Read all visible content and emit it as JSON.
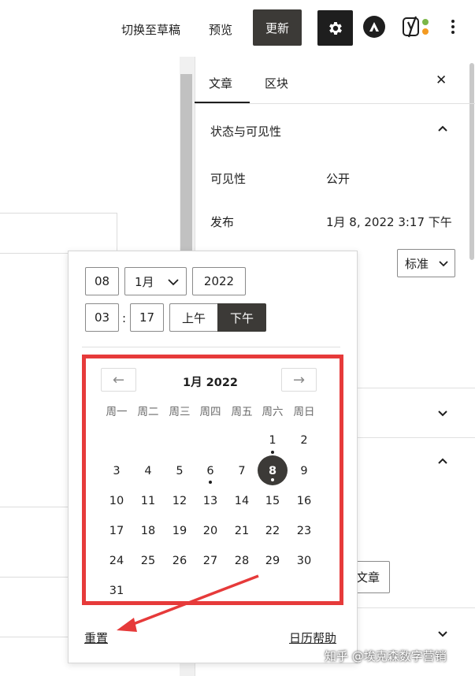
{
  "topbar": {
    "switch_to_draft": "切换至草稿",
    "preview": "预览",
    "update": "更新"
  },
  "icons": {
    "settings": "gear-icon",
    "plugin": "astra-logo-icon",
    "yoast": "yoast-seo-icon",
    "more": "more-vertical-icon"
  },
  "sidebar": {
    "tabs": [
      "文章",
      "区块"
    ],
    "close": "✕",
    "panel_title": "状态与可见性",
    "visibility_label": "可见性",
    "visibility_value": "公开",
    "publish_label": "发布",
    "publish_value": "1月 8, 2022 3:17 下午",
    "format_select": "标准",
    "partial_button": "文章"
  },
  "picker": {
    "day": "08",
    "month": "1月",
    "year": "2022",
    "hour": "03",
    "colon": ":",
    "minute": "17",
    "am": "上午",
    "pm": "下午",
    "month_title": "1月 2022",
    "prev_arrow": "←",
    "next_arrow": "→",
    "weekdays": [
      "周一",
      "周二",
      "周三",
      "周四",
      "周五",
      "周六",
      "周日"
    ],
    "days": [
      "1",
      "2",
      "3",
      "4",
      "5",
      "6",
      "7",
      "8",
      "9",
      "10",
      "11",
      "12",
      "13",
      "14",
      "15",
      "16",
      "17",
      "18",
      "19",
      "20",
      "21",
      "22",
      "23",
      "24",
      "25",
      "26",
      "27",
      "28",
      "29",
      "30",
      "31"
    ],
    "selected_day": "8",
    "reset": "重置",
    "help": "日历帮助"
  },
  "colors": {
    "accent_dark": "#3c3a37",
    "highlight_box": "#e63a3a",
    "annotation_arrow": "#e63a3a"
  },
  "watermark": "知乎 @埃克森数字营销"
}
